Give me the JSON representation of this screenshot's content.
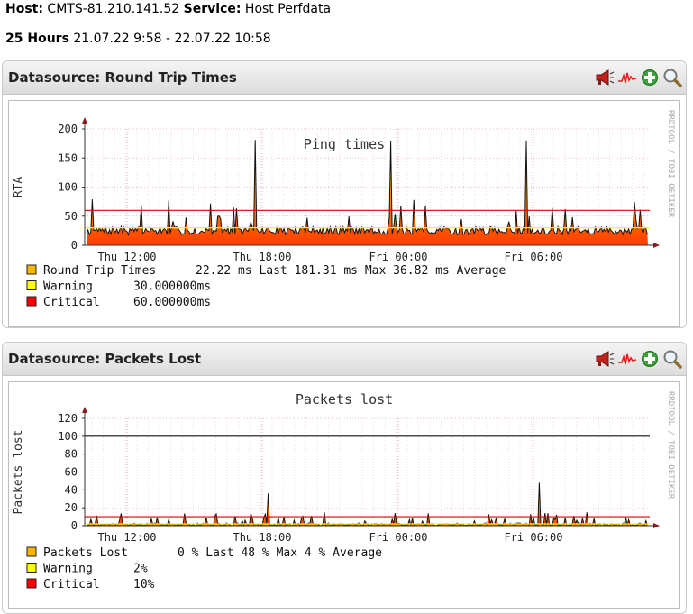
{
  "header": {
    "host_label": "Host:",
    "host_value": "CMTS-81.210.141.52",
    "service_label": "Service:",
    "service_value": "Host Perfdata",
    "range_label": "25 Hours",
    "range_value": "21.07.22 9:58 - 22.07.22 10:58"
  },
  "panels": [
    {
      "title": "Datasource: Round Trip Times",
      "actions": [
        "megaphone-icon",
        "sparkline-icon",
        "add-icon",
        "zoom-icon"
      ],
      "graph": {
        "title": "Ping times",
        "ylabel": "RTA",
        "watermark": "RRDTOOL / TOBI OETIKER",
        "legend": [
          {
            "color": "#f7b600",
            "name": "Round Trip Times",
            "stats": "22.22 ms Last    181.31 ms Max     36.82 ms Average"
          },
          {
            "color": "#ffff00",
            "name": "Warning",
            "stats": "30.000000ms"
          },
          {
            "color": "#ff0000",
            "name": "Critical",
            "stats": "60.000000ms"
          }
        ]
      }
    },
    {
      "title": "Datasource: Packets Lost",
      "actions": [
        "megaphone-icon",
        "sparkline-icon",
        "add-icon",
        "zoom-icon"
      ],
      "graph": {
        "title": "Packets lost",
        "ylabel": "Packets lost",
        "watermark": "RRDTOOL / TOBI OETIKER",
        "legend": [
          {
            "color": "#f7b600",
            "name": "Packets Lost",
            "stats": "0 % Last     48 % Max      4 % Average"
          },
          {
            "color": "#ffff00",
            "name": "Warning",
            "stats": "2%"
          },
          {
            "color": "#ff0000",
            "name": "Critical",
            "stats": "10%"
          }
        ]
      }
    }
  ],
  "chart_data": [
    {
      "type": "area",
      "title": "Ping times",
      "ylabel": "RTA",
      "xlabel": "",
      "ylim": [
        0,
        200
      ],
      "yticks": [
        "0",
        "50",
        "100",
        "150",
        "200"
      ],
      "xticks": [
        "Thu 12:00",
        "Thu 18:00",
        "Fri 00:00",
        "Fri 06:00"
      ],
      "grid": true,
      "thresholds": {
        "warning": 30,
        "critical": 60
      },
      "peaks": [
        {
          "x": "Thu 18:00",
          "value": 181
        },
        {
          "x": "Fri 00:00",
          "value": 180
        },
        {
          "x": "Fri 06:00",
          "value": 180
        }
      ],
      "series": [
        {
          "name": "Round Trip Times",
          "last": 22.22,
          "max": 181.31,
          "average": 36.82
        }
      ]
    },
    {
      "type": "area",
      "title": "Packets lost",
      "ylabel": "Packets lost",
      "xlabel": "",
      "ylim": [
        0,
        120
      ],
      "yticks": [
        "0",
        "20",
        "40",
        "60",
        "80",
        "100",
        "120"
      ],
      "xticks": [
        "Thu 12:00",
        "Thu 18:00",
        "Fri 00:00",
        "Fri 06:00"
      ],
      "grid": true,
      "reference_line": 100,
      "thresholds": {
        "warning": 2,
        "critical": 10
      },
      "peaks": [
        {
          "x": "Thu 18:00",
          "value": 36
        },
        {
          "x": "Fri 06:00",
          "value": 48
        }
      ],
      "series": [
        {
          "name": "Packets Lost",
          "last": 0,
          "max": 48,
          "average": 4
        }
      ]
    }
  ]
}
